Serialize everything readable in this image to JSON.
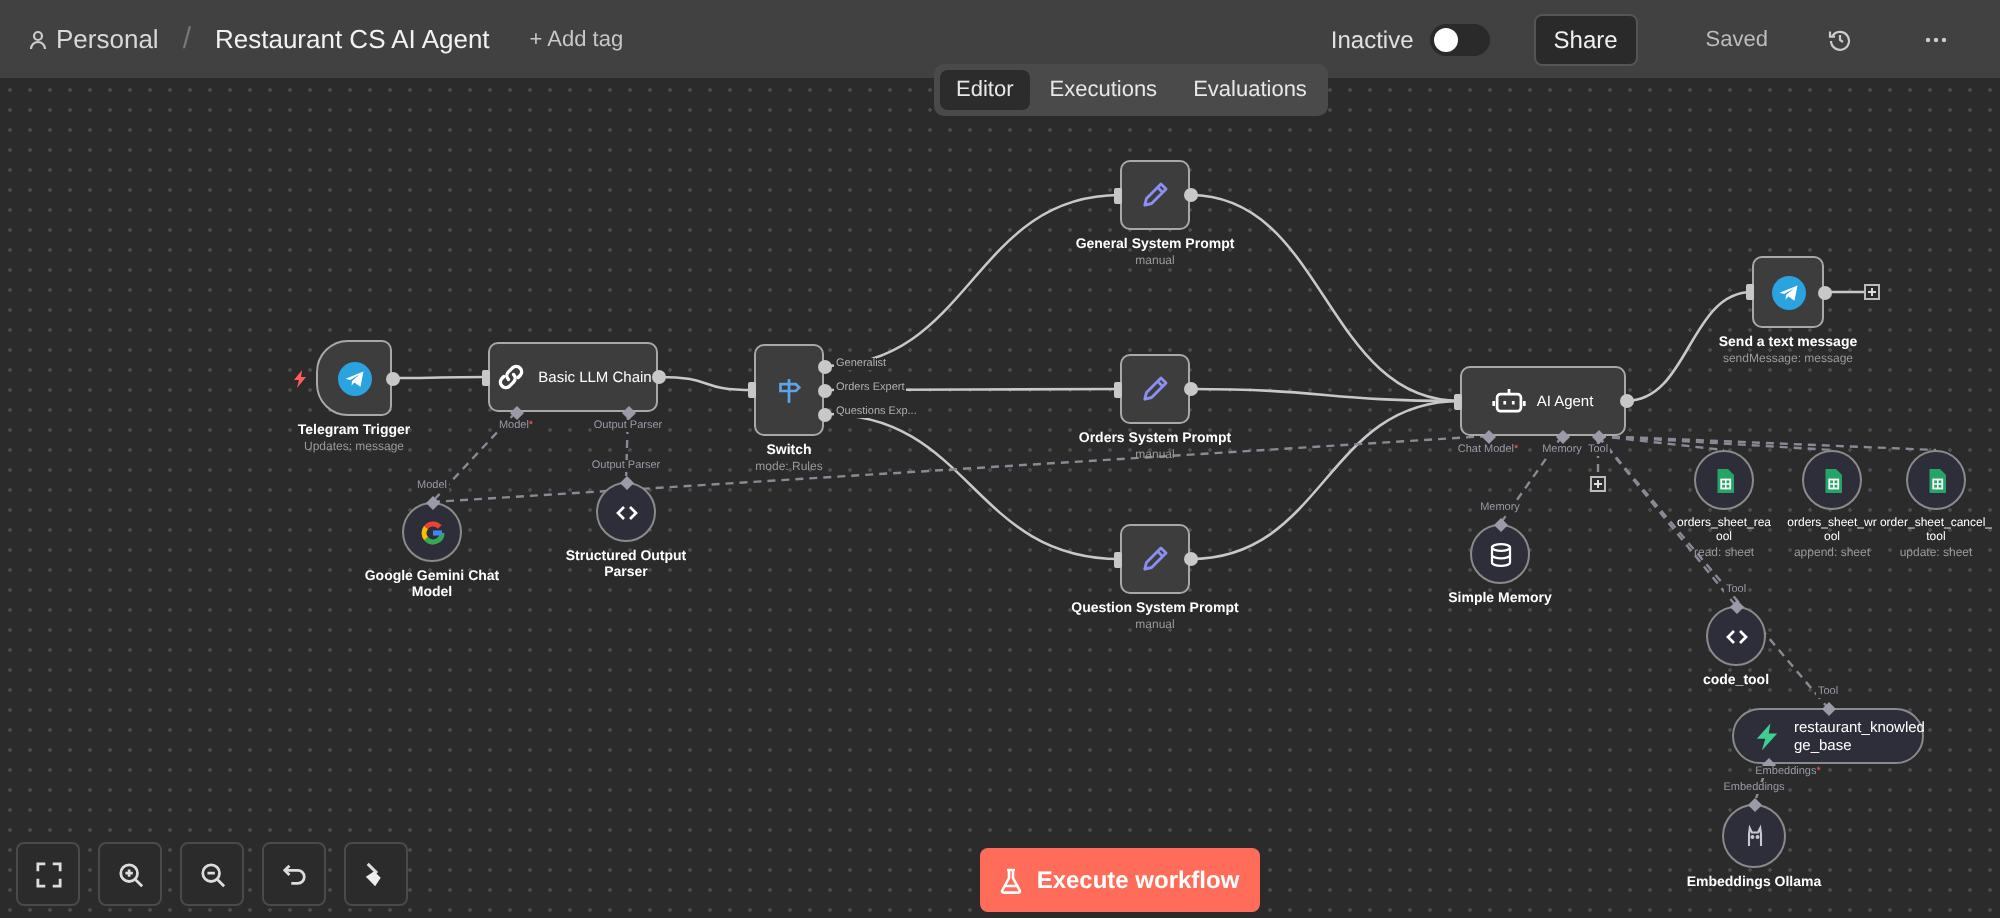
{
  "header": {
    "project": "Personal",
    "separator": "/",
    "workflow_name": "Restaurant CS AI Agent",
    "add_tag": "+ Add tag",
    "status_label": "Inactive",
    "active": false,
    "share": "Share",
    "save_status": "Saved"
  },
  "tabs": [
    {
      "label": "Editor",
      "selected": true
    },
    {
      "label": "Executions",
      "selected": false
    },
    {
      "label": "Evaluations",
      "selected": false
    }
  ],
  "nodes": [
    {
      "kind": "trigger",
      "label": "Telegram Trigger",
      "subtitle": "Updates: message"
    },
    {
      "kind": "wide",
      "label": "Basic LLM Chain",
      "ports": [
        {
          "label": "Model",
          "mark": "*"
        },
        {
          "label": "Output Parser"
        }
      ]
    },
    {
      "kind": "square",
      "label": "Switch",
      "subtitle": "mode: Rules",
      "outputs": [
        "Generalist",
        "Orders Expert",
        "Questions Exp..."
      ]
    },
    {
      "kind": "square",
      "label": "General System Prompt",
      "subtitle": "manual"
    },
    {
      "kind": "square",
      "label": "Orders System Prompt",
      "subtitle": "manual"
    },
    {
      "kind": "square",
      "label": "Question System Prompt",
      "subtitle": "manual"
    },
    {
      "kind": "wide",
      "label": "AI Agent",
      "ports": [
        {
          "label": "Chat Model",
          "mark": "*"
        },
        {
          "label": "Memory"
        },
        {
          "label": "Tool"
        }
      ]
    },
    {
      "kind": "square",
      "label": "Send a text message",
      "subtitle": "sendMessage: message"
    },
    {
      "kind": "circle",
      "label": "Google Gemini Chat Model",
      "port": {
        "label": "Model"
      }
    },
    {
      "kind": "circle",
      "label": "Structured Output Parser",
      "port": {
        "label": "Output Parser"
      }
    },
    {
      "kind": "circle",
      "label": "Simple Memory",
      "port": {
        "label": "Memory"
      }
    },
    {
      "kind": "circle",
      "label": "orders_sheet_rea\nool",
      "subtitle": "read: sheet"
    },
    {
      "kind": "circle",
      "label": "orders_sheet_wr\nool",
      "subtitle": "append: sheet"
    },
    {
      "kind": "circle",
      "label": "order_sheet_cancel_\ntool",
      "subtitle": "update: sheet"
    },
    {
      "kind": "circle",
      "label": "code_tool",
      "port": {
        "label": "Tool"
      }
    },
    {
      "kind": "pill",
      "label": "restaurant_knowled\nge_base",
      "port": {
        "label": "Tool"
      },
      "bottom_port": {
        "label": "Embeddings",
        "mark": "*"
      }
    },
    {
      "kind": "circle",
      "label": "Embeddings Ollama",
      "port": {
        "label": "Embeddings"
      }
    }
  ],
  "execute_button": "Execute workflow"
}
